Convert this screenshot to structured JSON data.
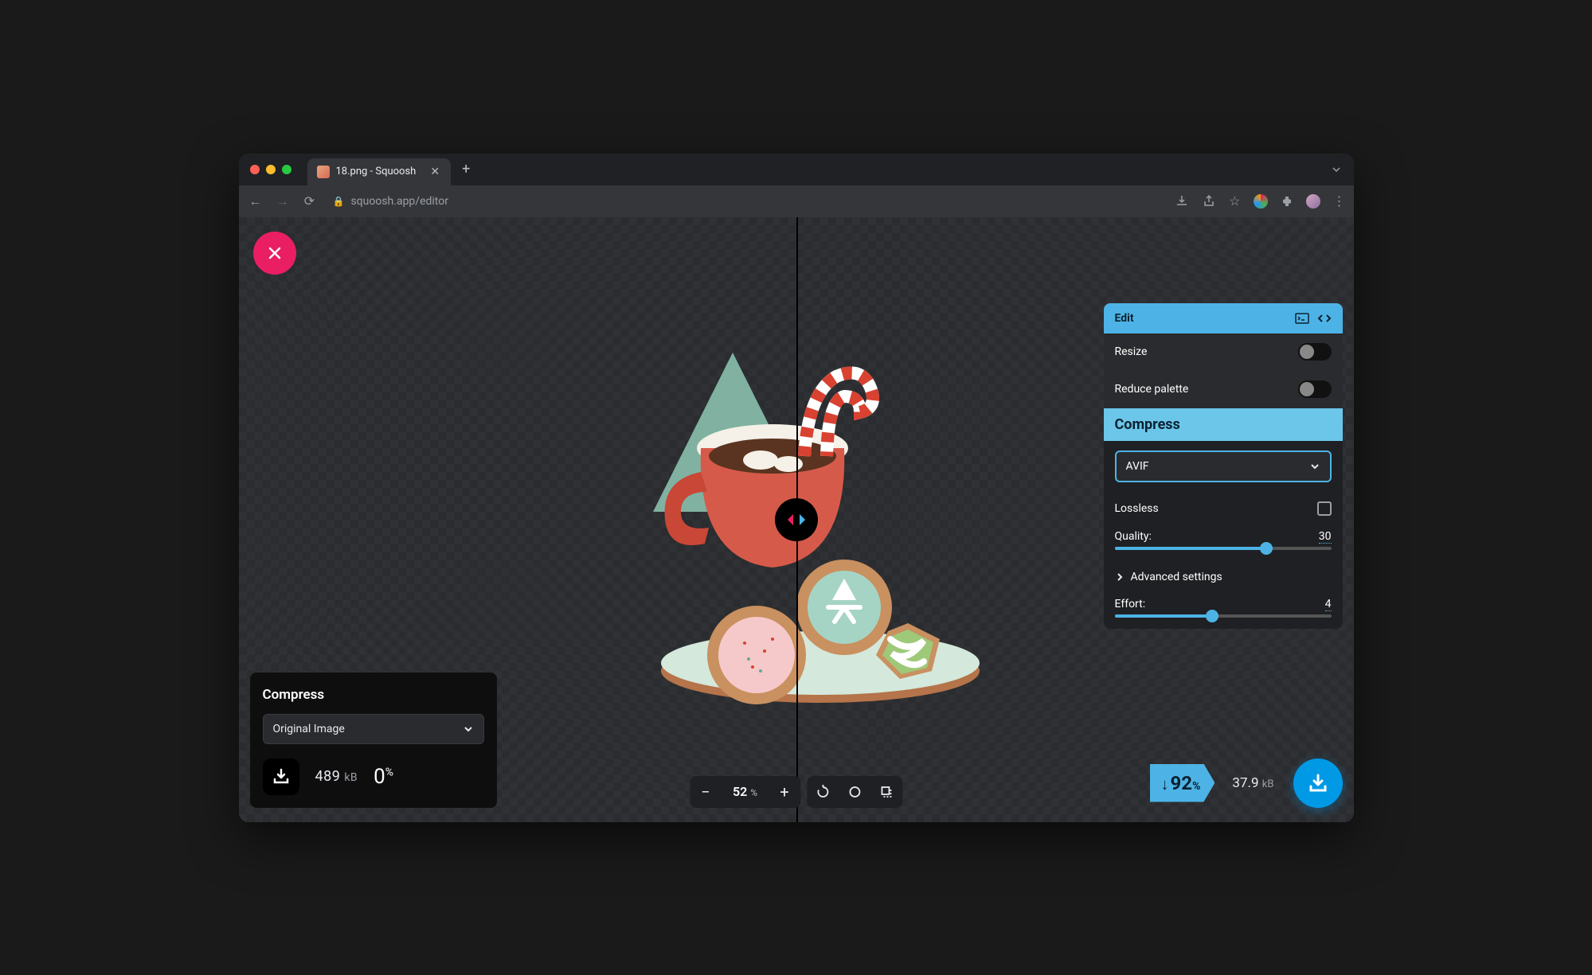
{
  "tab": {
    "title": "18.png - Squoosh"
  },
  "url": {
    "host": "squoosh.app",
    "path": "/editor"
  },
  "leftPanel": {
    "title": "Compress",
    "selectLabel": "Original Image",
    "size": "489",
    "sizeUnit": "kB",
    "percent": "0",
    "percentUnit": "%"
  },
  "rightPanel": {
    "editTitle": "Edit",
    "resizeLabel": "Resize",
    "paletteLabel": "Reduce palette",
    "compressTitle": "Compress",
    "codec": "AVIF",
    "losslessLabel": "Lossless",
    "qualityLabel": "Quality:",
    "qualityValue": "30",
    "advancedLabel": "Advanced settings",
    "effortLabel": "Effort:",
    "effortValue": "4"
  },
  "savings": {
    "percent": "92",
    "percentUnit": "%",
    "size": "37.9",
    "sizeUnit": "kB"
  },
  "zoom": {
    "value": "52",
    "unit": "%"
  }
}
